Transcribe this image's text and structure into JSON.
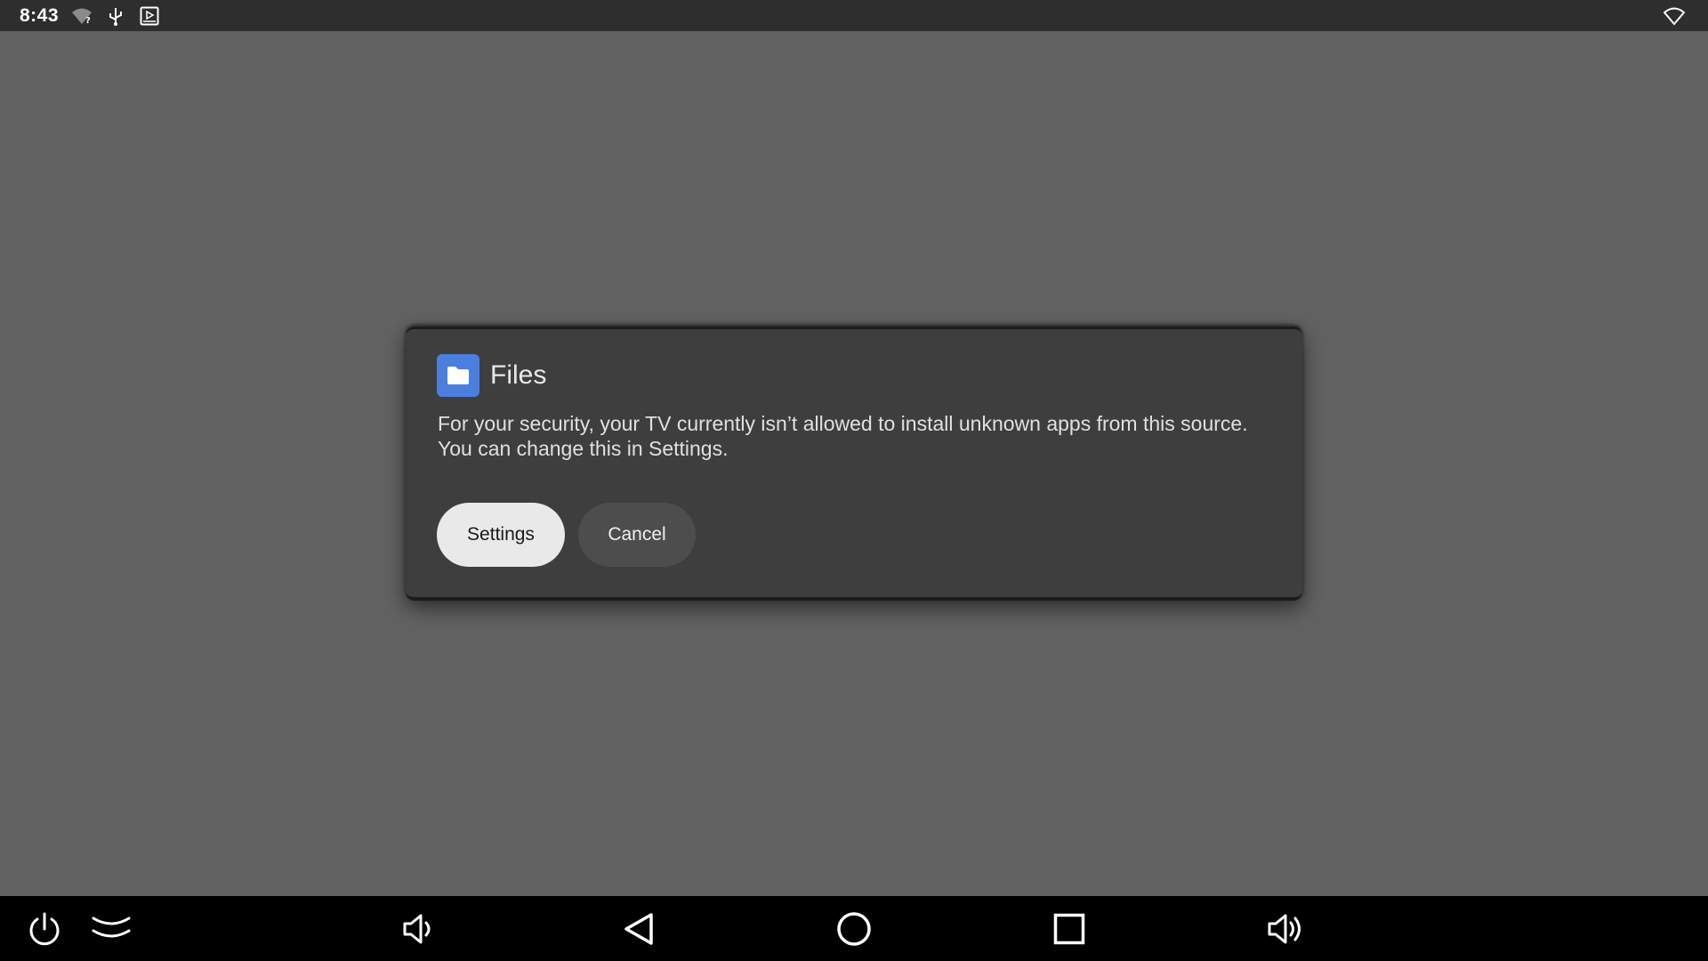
{
  "status_bar": {
    "time": "8:43",
    "left_icons": [
      "wifi-question-icon",
      "usb-icon",
      "screen-cast-icon"
    ],
    "right_icons": [
      "wifi-icon"
    ]
  },
  "dialog": {
    "app_icon": "folder-icon",
    "app_name": "Files",
    "message": "For your security, your TV currently isn’t allowed to install unknown apps from this source. You can change this in Settings.",
    "primary_button": "Settings",
    "secondary_button": "Cancel"
  },
  "nav_bar": {
    "buttons": [
      "power-icon",
      "expand-icon",
      "volume-down-icon",
      "back-icon",
      "home-icon",
      "recents-icon",
      "volume-up-icon"
    ]
  },
  "colors": {
    "background": "#626262",
    "status_bar": "#2e2e2e",
    "dialog": "#3e3e3e",
    "primary_button": "#e9e9e9",
    "secondary_button": "#4d4d4d",
    "app_icon": "#4a7fe0",
    "nav_bar": "#000000"
  }
}
